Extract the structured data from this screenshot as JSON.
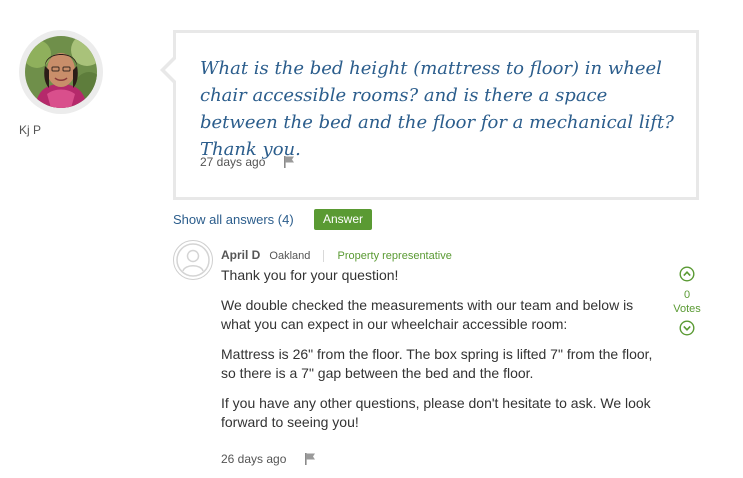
{
  "question": {
    "asker_name": "Kj P",
    "text": "What is the bed height (mattress to floor) in wheel chair accessible rooms? and is there a space between the bed and the floor for a mechanical lift? Thank you.",
    "posted": "27 days ago"
  },
  "answers_bar": {
    "show_all_label": "Show all answers (4)",
    "answer_button_label": "Answer"
  },
  "answer": {
    "responder_name": "April D",
    "responder_location": "Oakland",
    "responder_role": "Property representative",
    "paragraphs": [
      "Thank you for your question!",
      "We double checked the measurements with our team and below is what you can expect in our wheelchair accessible room:",
      "Mattress is 26\" from the floor. The box spring is lifted 7\" from the floor, so there is a 7\" gap between the bed and the floor.",
      "If you have any other questions, please don't hesitate to ask. We look forward to seeing you!"
    ],
    "posted": "26 days ago",
    "votes": {
      "count": "0",
      "label": "Votes"
    }
  },
  "colors": {
    "link_blue": "#2b5d8c",
    "accent_green": "#5a9a33",
    "box_border": "#e8e8e8"
  },
  "icons": [
    "flag-icon",
    "upvote-icon",
    "downvote-icon",
    "default-avatar-icon"
  ]
}
